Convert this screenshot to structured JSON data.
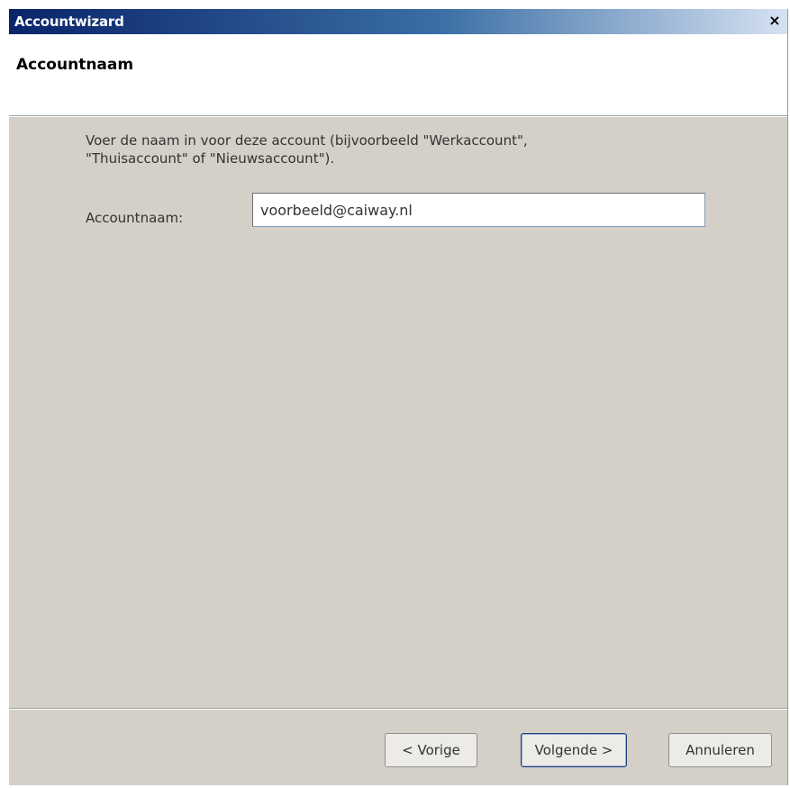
{
  "window": {
    "title": "Accountwizard",
    "close_glyph": "×"
  },
  "header": {
    "title": "Accountnaam"
  },
  "main": {
    "description_line1": "Voer de naam in voor deze account (bijvoorbeeld \"Werkaccount\",",
    "description_line2": "\"Thuisaccount\" of \"Nieuwsaccount\").",
    "account_label": "Accountnaam:",
    "account_value": "voorbeeld@caiway.nl"
  },
  "footer": {
    "prev_label": "< Vorige",
    "next_label": "Volgende >",
    "cancel_label": "Annuleren"
  }
}
